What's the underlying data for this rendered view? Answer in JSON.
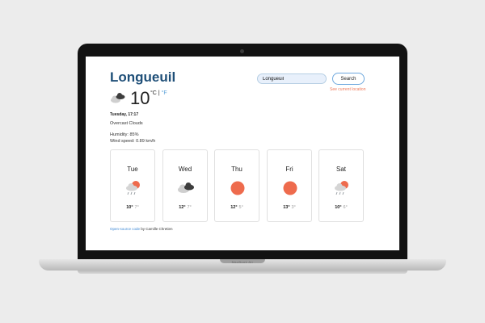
{
  "app": {
    "city": "Longueuil",
    "search": {
      "value": "Longueuil",
      "button_label": "Search",
      "location_link": "See current location"
    },
    "current": {
      "temperature": "10",
      "unit_c": "°C",
      "separator": "|",
      "unit_f": "°F",
      "datetime": "Tuesday, 17:17",
      "description": "Overcast Clouds",
      "humidity": "Humidity: 85%",
      "wind": "Wind speed: 0.89 km/h",
      "icon": "overcast-clouds-icon"
    },
    "forecast": [
      {
        "day": "Tue",
        "high": "10°",
        "low": "7°",
        "icon": "rain-icon"
      },
      {
        "day": "Wed",
        "high": "12°",
        "low": "7°",
        "icon": "clouds-icon"
      },
      {
        "day": "Thu",
        "high": "12°",
        "low": "5°",
        "icon": "sun-icon"
      },
      {
        "day": "Fri",
        "high": "13°",
        "low": "3°",
        "icon": "sun-icon"
      },
      {
        "day": "Sat",
        "high": "10°",
        "low": "6°",
        "icon": "rain-icon"
      }
    ],
    "footer": {
      "link_text": "Open-source code",
      "rest": " by Camille Chretien"
    }
  },
  "device": {
    "label": "MacBook Air"
  },
  "colors": {
    "accent": "#1f4f78",
    "sun": "#ee6b4d",
    "link": "#3a86d4",
    "location_link": "#ee7a5a"
  }
}
